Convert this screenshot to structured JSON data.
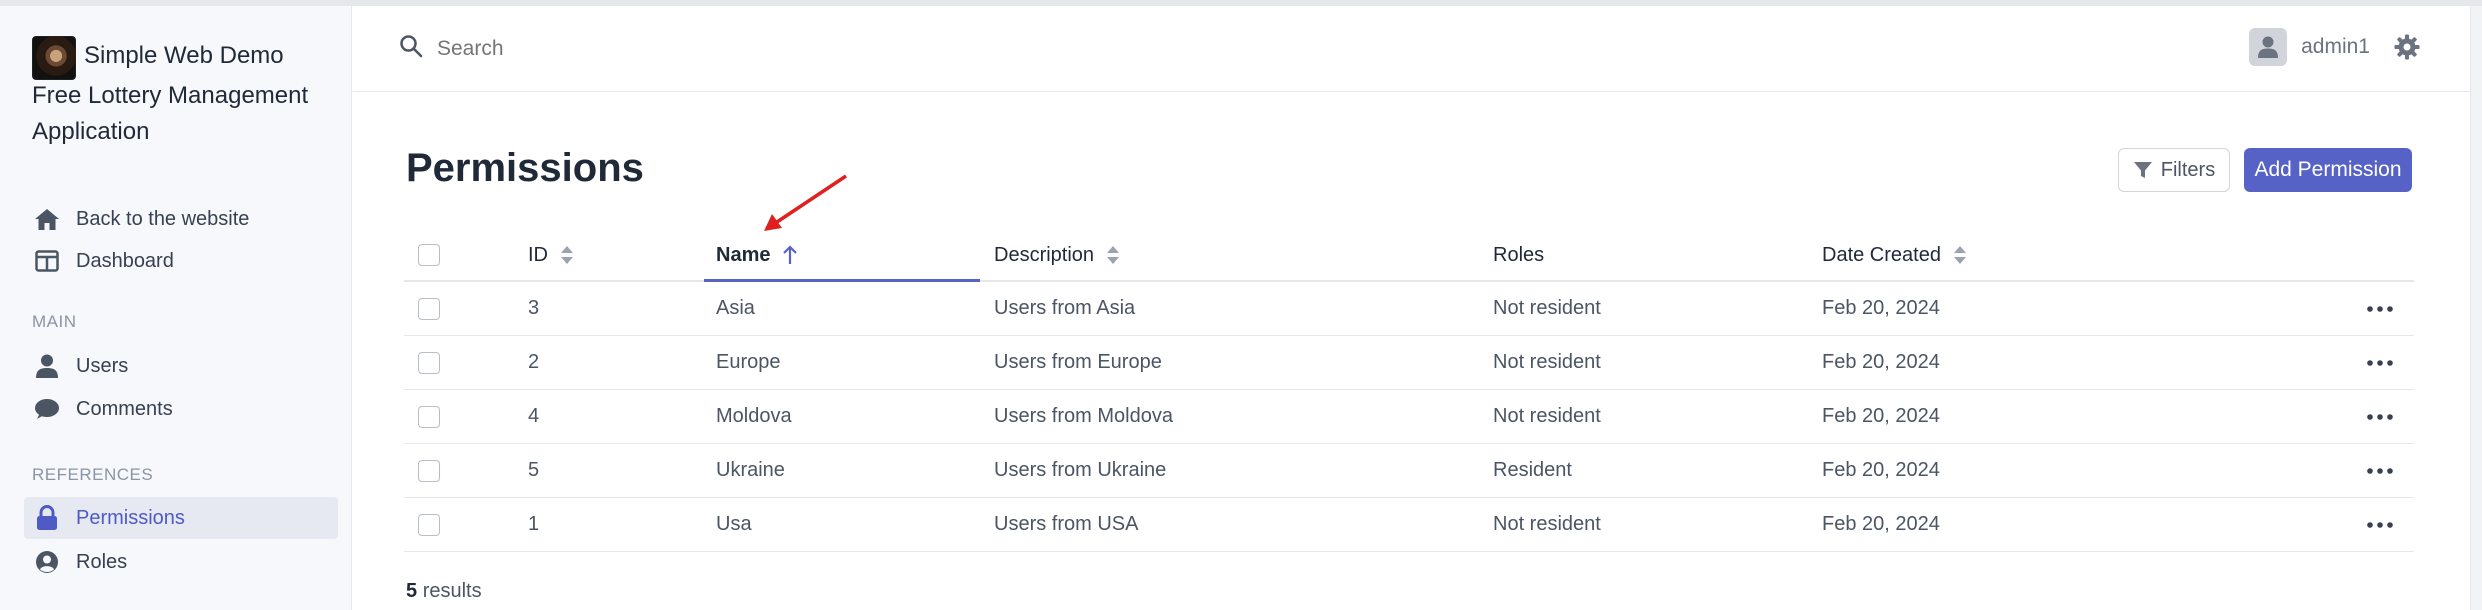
{
  "app": {
    "name": "Simple Web Demo",
    "subtitle": "Free Lottery Management Application"
  },
  "sidebar": {
    "items": [
      {
        "label": "Back to the website",
        "icon": "home-icon"
      },
      {
        "label": "Dashboard",
        "icon": "dashboard-icon"
      }
    ],
    "main_label": "MAIN",
    "main_items": [
      {
        "label": "Users",
        "icon": "user-icon"
      },
      {
        "label": "Comments",
        "icon": "comment-icon"
      }
    ],
    "references_label": "REFERENCES",
    "references_items": [
      {
        "label": "Permissions",
        "icon": "lock-icon",
        "active": true
      },
      {
        "label": "Roles",
        "icon": "user-circle-icon"
      }
    ]
  },
  "header": {
    "search_placeholder": "Search",
    "username": "admin1"
  },
  "page": {
    "title": "Permissions",
    "filters_label": "Filters",
    "add_label": "Add Permission"
  },
  "table": {
    "columns": {
      "id": "ID",
      "name": "Name",
      "description": "Description",
      "roles": "Roles",
      "date_created": "Date Created"
    },
    "sorted_by": "Name",
    "sort_direction": "ascending",
    "rows": [
      {
        "id": "3",
        "name": "Asia",
        "description": "Users from Asia",
        "roles": "Not resident",
        "date": "Feb 20, 2024"
      },
      {
        "id": "2",
        "name": "Europe",
        "description": "Users from Europe",
        "roles": "Not resident",
        "date": "Feb 20, 2024"
      },
      {
        "id": "4",
        "name": "Moldova",
        "description": "Users from Moldova",
        "roles": "Not resident",
        "date": "Feb 20, 2024"
      },
      {
        "id": "5",
        "name": "Ukraine",
        "description": "Users from Ukraine",
        "roles": "Resident",
        "date": "Feb 20, 2024"
      },
      {
        "id": "1",
        "name": "Usa",
        "description": "Users from USA",
        "roles": "Not resident",
        "date": "Feb 20, 2024"
      }
    ]
  },
  "footer": {
    "count": "5",
    "results_label": "results"
  },
  "colors": {
    "accent": "#5662c6",
    "sidebar_bg": "#f6f8fb",
    "annotation_arrow": "#e02020"
  }
}
